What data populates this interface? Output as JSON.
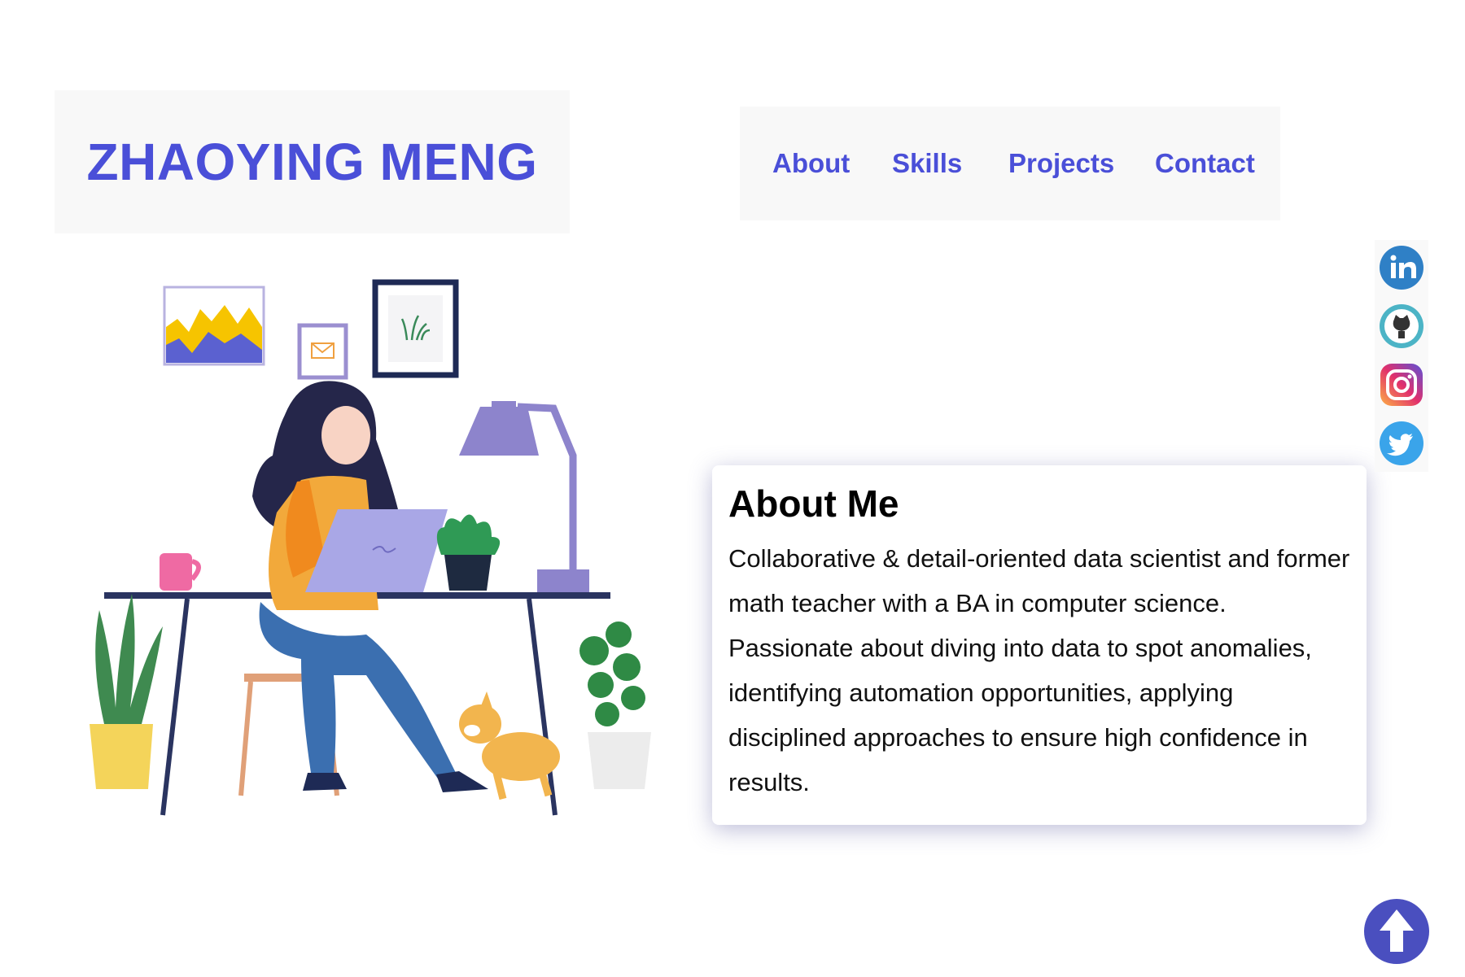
{
  "header": {
    "logo_text": "ZHAOYING MENG"
  },
  "nav": {
    "items": [
      {
        "label": "About"
      },
      {
        "label": "Skills"
      },
      {
        "label": "Projects"
      },
      {
        "label": "Contact"
      }
    ]
  },
  "about": {
    "title": "About Me",
    "body": "Collaborative & detail-oriented data scientist and former math teacher with a BA in computer science. Passionate about diving into data to spot anomalies, identifying automation opportunities, applying disciplined approaches to ensure high confidence in results."
  },
  "social": {
    "icons": [
      "linkedin-icon",
      "github-icon",
      "instagram-icon",
      "twitter-icon"
    ]
  },
  "colors": {
    "brand": "#4a4fd8",
    "background": "#ffffff",
    "panel": "#f8f8f8",
    "scroll_button": "#4a4fbf"
  },
  "illustration": {
    "description_icon": "woman-working-at-desk-illustration"
  }
}
